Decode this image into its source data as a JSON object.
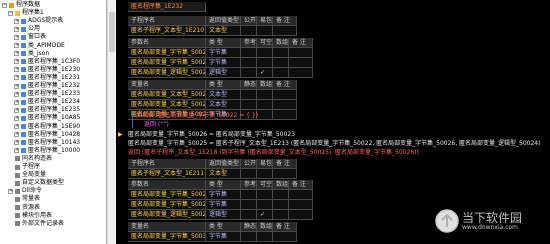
{
  "tree": {
    "items": [
      {
        "label": "程序数据",
        "toggle": "−",
        "icon": "#e0a000"
      },
      {
        "label": "程序集1",
        "toggle": "−",
        "icon": "#f0c040"
      },
      {
        "label": "ADGS提示表",
        "toggle": "+",
        "icon": "#4a86d8"
      },
      {
        "label": "公用",
        "toggle": "+",
        "icon": "#4a86d8"
      },
      {
        "label": "窗口表",
        "toggle": "+",
        "icon": "#4a86d8"
      },
      {
        "label": "类_APIMODE",
        "toggle": "+",
        "icon": "#4a86d8"
      },
      {
        "label": "类_json",
        "toggle": "+",
        "icon": "#4a86d8"
      },
      {
        "label": "匿名程序集_1C3F0",
        "toggle": "+",
        "icon": "#4a86d8"
      },
      {
        "label": "匿名程序集_1E230",
        "toggle": "+",
        "icon": "#4a86d8"
      },
      {
        "label": "匿名程序集_1E231",
        "toggle": "+",
        "icon": "#4a86d8"
      },
      {
        "label": "匿名程序集_1E232",
        "toggle": "+",
        "icon": "#4a86d8"
      },
      {
        "label": "匿名程序集_1E233",
        "toggle": "+",
        "icon": "#4a86d8"
      },
      {
        "label": "匿名程序集_1E234",
        "toggle": "+",
        "icon": "#4a86d8"
      },
      {
        "label": "匿名程序集_1E235",
        "toggle": "+",
        "icon": "#4a86d8"
      },
      {
        "label": "匿名程序集_10A85",
        "toggle": "+",
        "icon": "#4a86d8"
      },
      {
        "label": "匿名程序集_15E90",
        "toggle": "+",
        "icon": "#4a86d8"
      },
      {
        "label": "匿名程序集_10428",
        "toggle": "+",
        "icon": "#4a86d8"
      },
      {
        "label": "匿名程序集_10143",
        "toggle": "+",
        "icon": "#4a86d8"
      },
      {
        "label": "匿名程序集_10000",
        "toggle": "+",
        "icon": "#4a86d8"
      },
      {
        "label": "同名构造表",
        "toggle": "",
        "icon": "#808080"
      },
      {
        "label": "子程序",
        "toggle": "",
        "icon": "#808080"
      },
      {
        "label": "全局变量",
        "toggle": "",
        "icon": "#808080"
      },
      {
        "label": "自定义数据类型",
        "toggle": "",
        "icon": "#808080"
      },
      {
        "label": "Dll命令",
        "toggle": "+",
        "icon": "#808080"
      },
      {
        "label": "常量表",
        "toggle": "",
        "icon": "#808080"
      },
      {
        "label": "资源表",
        "toggle": "",
        "icon": "#808080"
      },
      {
        "label": "模块引用表",
        "toggle": "",
        "icon": "#808080"
      },
      {
        "label": "外部文件记录表",
        "toggle": "",
        "icon": "#808080"
      }
    ]
  },
  "code": {
    "b1_title": "匿名程序集_1E232",
    "b1_headers": [
      "子程序名",
      "返回值类型",
      "公开",
      "易包",
      "备 注"
    ],
    "b1_sub": [
      "匿名子程序_文本型_1E210",
      "文本型",
      "",
      "",
      ""
    ],
    "b1_pheaders": [
      "参数名",
      "类 型",
      "参考",
      "可空",
      "数组",
      "备 注"
    ],
    "b1_params": [
      [
        "匿名局部变量_字节集_50022",
        "字节集",
        "",
        "",
        "",
        ""
      ],
      [
        "匿名局部变量_字节集_50023",
        "字节集",
        "",
        "",
        "",
        ""
      ],
      [
        "匿名局部变量_逻辑型_50024",
        "逻辑型",
        "",
        "✓",
        "",
        ""
      ]
    ],
    "b1_vheaders": [
      "变量名",
      "类 型",
      "静态",
      "数组",
      "备 注"
    ],
    "b1_vars": [
      [
        "匿名局部变量_文本型_50025",
        "文本型",
        "",
        "",
        ""
      ],
      [
        "匿名局部变量_文本型_50026",
        "文本型",
        "",
        "",
        ""
      ],
      [
        "匿名局部变量_字节集_50027",
        "字节集",
        "",
        "",
        ""
      ]
    ],
    "line1": "如果真 (匿名局部变量_字节集_50022 = { })",
    "line2": "返回 (“”)",
    "line3": "匿名局部变量_字节集_50026 = 匿名局部变量_字节集_50023",
    "line4": "匿名局部变量_字节集_50025 = 匿名子程序_文本型_1E213 (匿名局部变量_字节集_50022, 匿名局部变量_字节集_50026, 匿名局部变量_逻辑型_50024)",
    "line5": "返回 (匿名子程序_文本型_1E218 (到字节集 (匿名局部变量_文本型_50025), 匿名局部变量_字节集_50026))",
    "b2_headers": [
      "子程序名",
      "返回值类型",
      "公开",
      "易包",
      "备 注"
    ],
    "b2_sub": [
      "匿名子程序_文本型_1E211",
      "文本型",
      "",
      "",
      ""
    ],
    "b2_pheaders": [
      "参数名",
      "类 型",
      "参考",
      "可空",
      "数组",
      "备 注"
    ],
    "b2_params": [
      [
        "匿名局部变量_字节集_50027",
        "字节集",
        "",
        "",
        "",
        ""
      ],
      [
        "匿名局部变量_字节集_50028",
        "字节集",
        "",
        "",
        "",
        ""
      ],
      [
        "匿名局部变量_逻辑型_50029",
        "逻辑型",
        "",
        "✓",
        "",
        ""
      ]
    ],
    "b2_vheaders": [
      "变量名",
      "类 型",
      "静态",
      "数组",
      "备 注"
    ],
    "b2_vars": [
      [
        "匿名局部变量_字节集_50030",
        "字节集",
        "",
        "",
        ""
      ]
    ]
  },
  "watermark": {
    "title": "当下软件园",
    "url": "www.downxia.com"
  }
}
